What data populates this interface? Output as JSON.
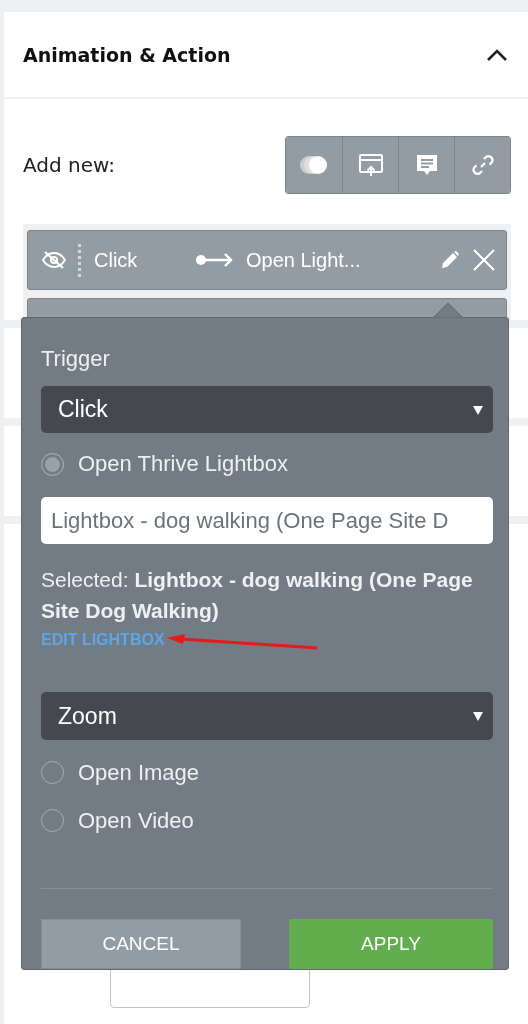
{
  "panel": {
    "title": "Animation & Action",
    "expanded": true,
    "add_new_label": "Add new:"
  },
  "actions": [
    {
      "trigger": "Click",
      "action": "Open Light..."
    }
  ],
  "popup": {
    "trigger_label": "Trigger",
    "trigger_value": "Click",
    "options": [
      {
        "label": "Open Thrive Lightbox",
        "selected": true
      },
      {
        "label": "Open Image",
        "selected": false
      },
      {
        "label": "Open Video",
        "selected": false
      }
    ],
    "lightbox_value": "Lightbox - dog walking (One Page Site D",
    "selected_text": "Selected: **Lightbox - dog walking (One Page Site Dog Walking)**",
    "edit_link": "EDIT LIGHTBOX",
    "animation_value": "Zoom",
    "cancel": "CANCEL",
    "apply": "APPLY"
  }
}
